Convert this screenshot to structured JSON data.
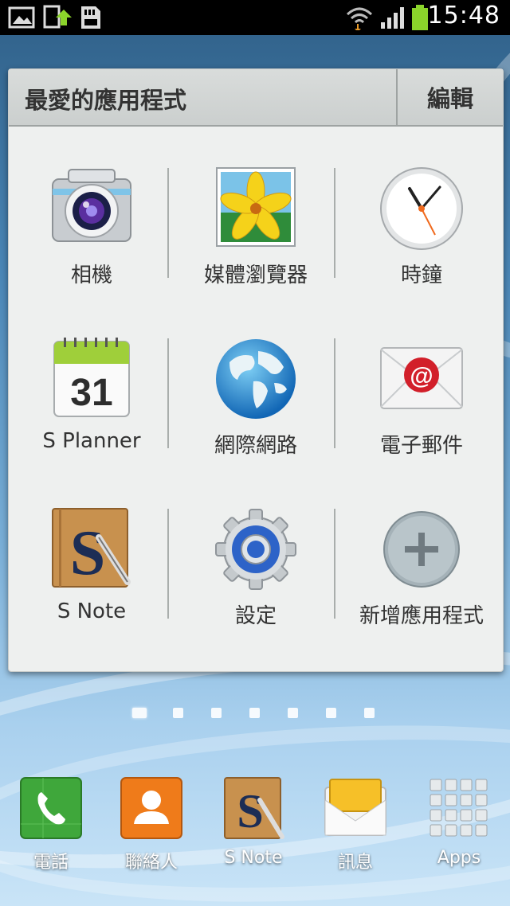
{
  "status_bar": {
    "time": "15:48",
    "icons": [
      "gallery-icon",
      "sync-upload-icon",
      "sd-card-icon",
      "wifi-icon",
      "signal-icon",
      "battery-icon"
    ],
    "battery_color": "#8bd42b"
  },
  "folder": {
    "title": "最愛的應用程式",
    "edit_label": "編輯",
    "apps": [
      {
        "label": "相機",
        "icon": "camera-icon"
      },
      {
        "label": "媒體瀏覽器",
        "icon": "gallery-flower-icon"
      },
      {
        "label": "時鐘",
        "icon": "clock-icon"
      },
      {
        "label": "S Planner",
        "icon": "calendar-icon",
        "day": "31"
      },
      {
        "label": "網際網路",
        "icon": "globe-icon"
      },
      {
        "label": "電子郵件",
        "icon": "email-icon"
      },
      {
        "label": "S Note",
        "icon": "s-note-icon"
      },
      {
        "label": "設定",
        "icon": "settings-gear-icon"
      },
      {
        "label": "新增應用程式",
        "icon": "add-app-icon"
      }
    ]
  },
  "page_indicator": {
    "count": 7,
    "active": 0
  },
  "dock": [
    {
      "label": "電話",
      "icon": "phone-icon"
    },
    {
      "label": "聯絡人",
      "icon": "contacts-icon"
    },
    {
      "label": "S Note",
      "icon": "s-note-icon"
    },
    {
      "label": "訊息",
      "icon": "messages-icon"
    },
    {
      "label": "Apps",
      "icon": "apps-grid-icon"
    }
  ]
}
